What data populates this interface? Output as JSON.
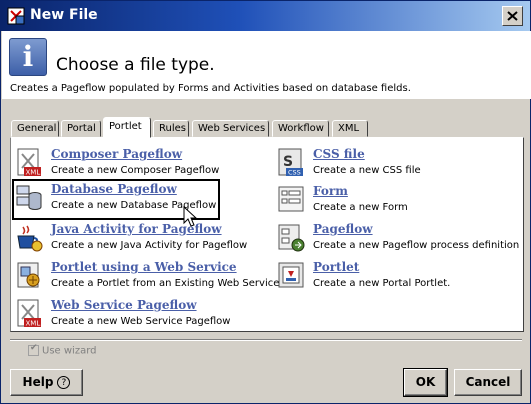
{
  "window": {
    "title": "New File"
  },
  "header": {
    "title": "Choose a file type.",
    "description": "Creates a Pageflow populated by Forms and Activities based on database fields."
  },
  "tabs": [
    {
      "label": "General",
      "active": false
    },
    {
      "label": "Portal",
      "active": false
    },
    {
      "label": "Portlet",
      "active": true
    },
    {
      "label": "Rules",
      "active": false
    },
    {
      "label": "Web Services",
      "active": false
    },
    {
      "label": "Workflow",
      "active": false
    },
    {
      "label": "XML",
      "active": false
    }
  ],
  "items": [
    {
      "name": "Composer Pageflow",
      "desc": "Create a new Composer Pageflow",
      "icon": "xml-document-icon"
    },
    {
      "name": "Database Pageflow",
      "desc": "Create a new Database Pageflow",
      "icon": "database-pageflow-icon",
      "selected": true
    },
    {
      "name": "Java Activity for Pageflow",
      "desc": "Create a new Java Activity for Pageflow",
      "icon": "java-cup-icon"
    },
    {
      "name": "Portlet using a Web Service",
      "desc": "Create a Portlet from an Existing Web Service.",
      "icon": "portlet-webservice-icon"
    },
    {
      "name": "Web Service Pageflow",
      "desc": "Create a new Web Service Pageflow",
      "icon": "xml-document-icon"
    },
    {
      "name": "CSS file",
      "desc": "Create a new CSS file",
      "icon": "css-file-icon"
    },
    {
      "name": "Form",
      "desc": "Create a new Form",
      "icon": "form-icon"
    },
    {
      "name": "Pageflow",
      "desc": "Create a new Pageflow process definition",
      "icon": "pageflow-icon"
    },
    {
      "name": "Portlet",
      "desc": "Create a new Portal Portlet.",
      "icon": "portlet-icon"
    }
  ],
  "options": {
    "use_wizard": "Use wizard",
    "use_wizard_checked": true,
    "use_wizard_enabled": false
  },
  "buttons": {
    "help": "Help",
    "ok": "OK",
    "cancel": "Cancel"
  }
}
